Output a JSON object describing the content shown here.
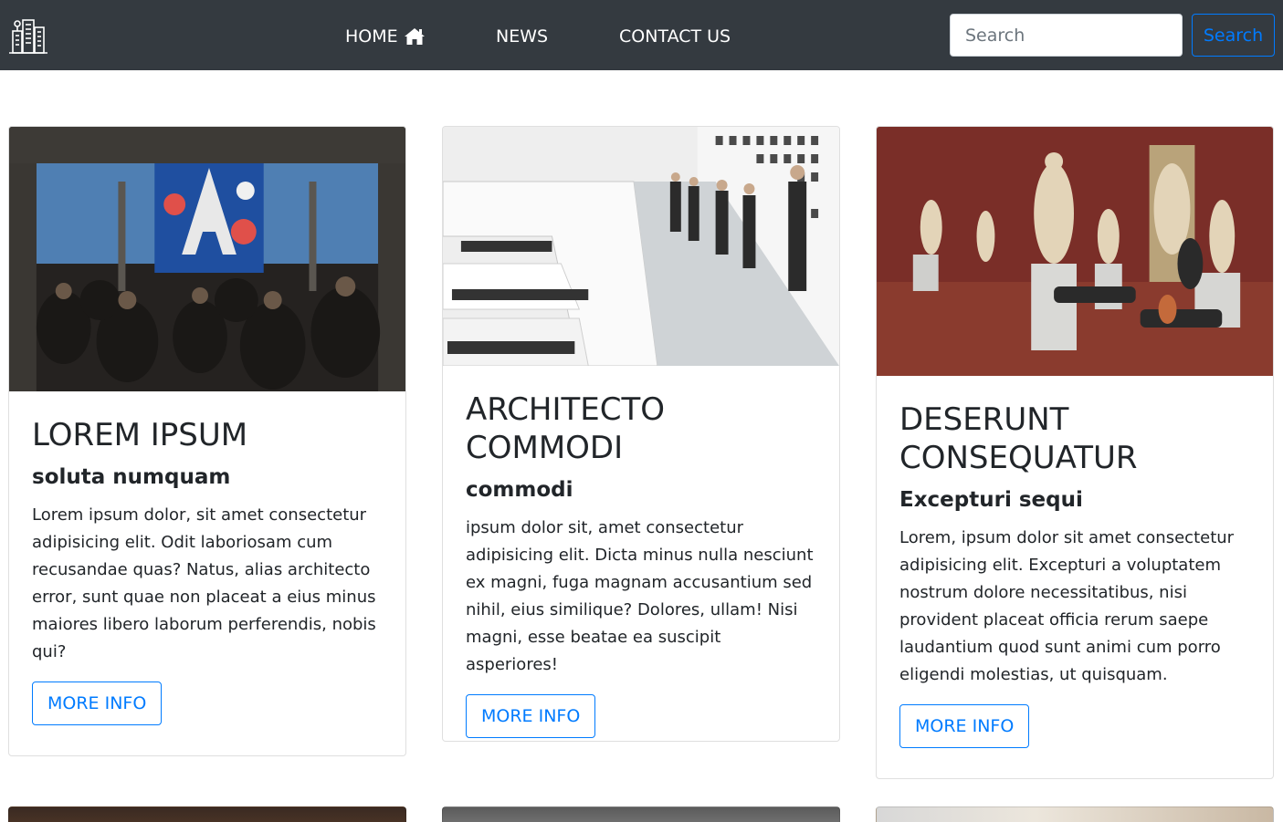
{
  "nav": {
    "logo_icon": "city-buildings-icon",
    "home_label": "HOME",
    "home_icon": "home-icon",
    "news_label": "NEWS",
    "contact_label": "CONTACT US",
    "search_placeholder": "Search",
    "search_button": "Search"
  },
  "colors": {
    "navbar_bg": "#343a40",
    "accent": "#007bff"
  },
  "cards": [
    {
      "image": "event-hall-photo",
      "title": "LOREM IPSUM",
      "subtitle": "soluta numquam",
      "text": "Lorem ipsum dolor, sit amet consectetur adipisicing elit. Odit laboriosam cum recusandae quas? Natus, alias architecto error, sunt quae non placeat a eius minus maiores libero laborum perferendis, nobis qui?",
      "button": "MORE INFO"
    },
    {
      "image": "gallery-staircase-photo",
      "title": "ARCHITECTO COMMODI",
      "subtitle": "commodi",
      "text": "ipsum dolor sit, amet consectetur adipisicing elit. Dicta minus nulla nesciunt ex magni, fuga magnam accusantium sed nihil, eius similique? Dolores, ullam! Nisi magni, esse beatae ea suscipit asperiores!",
      "button": "MORE INFO"
    },
    {
      "image": "sculpture-museum-photo",
      "title": "DESERUNT CONSEQUATUR",
      "subtitle": "Excepturi sequi",
      "text": "Lorem, ipsum dolor sit amet consectetur adipisicing elit. Excepturi a voluptatem nostrum dolore necessitatibus, nisi provident placeat officia rerum saepe laudantium quod sunt animi cum porro eligendi molestias, ut quisquam.",
      "button": "MORE INFO"
    }
  ]
}
